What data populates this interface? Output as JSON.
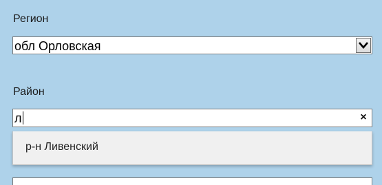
{
  "region": {
    "label": "Регион",
    "value": "обл Орловская"
  },
  "district": {
    "label": "Район",
    "value": "л",
    "clear_symbol": "×",
    "suggestions": [
      "р-н Ливенский"
    ]
  },
  "icons": {
    "select_toggle": "chevron-down-icon",
    "clear": "close-icon"
  }
}
